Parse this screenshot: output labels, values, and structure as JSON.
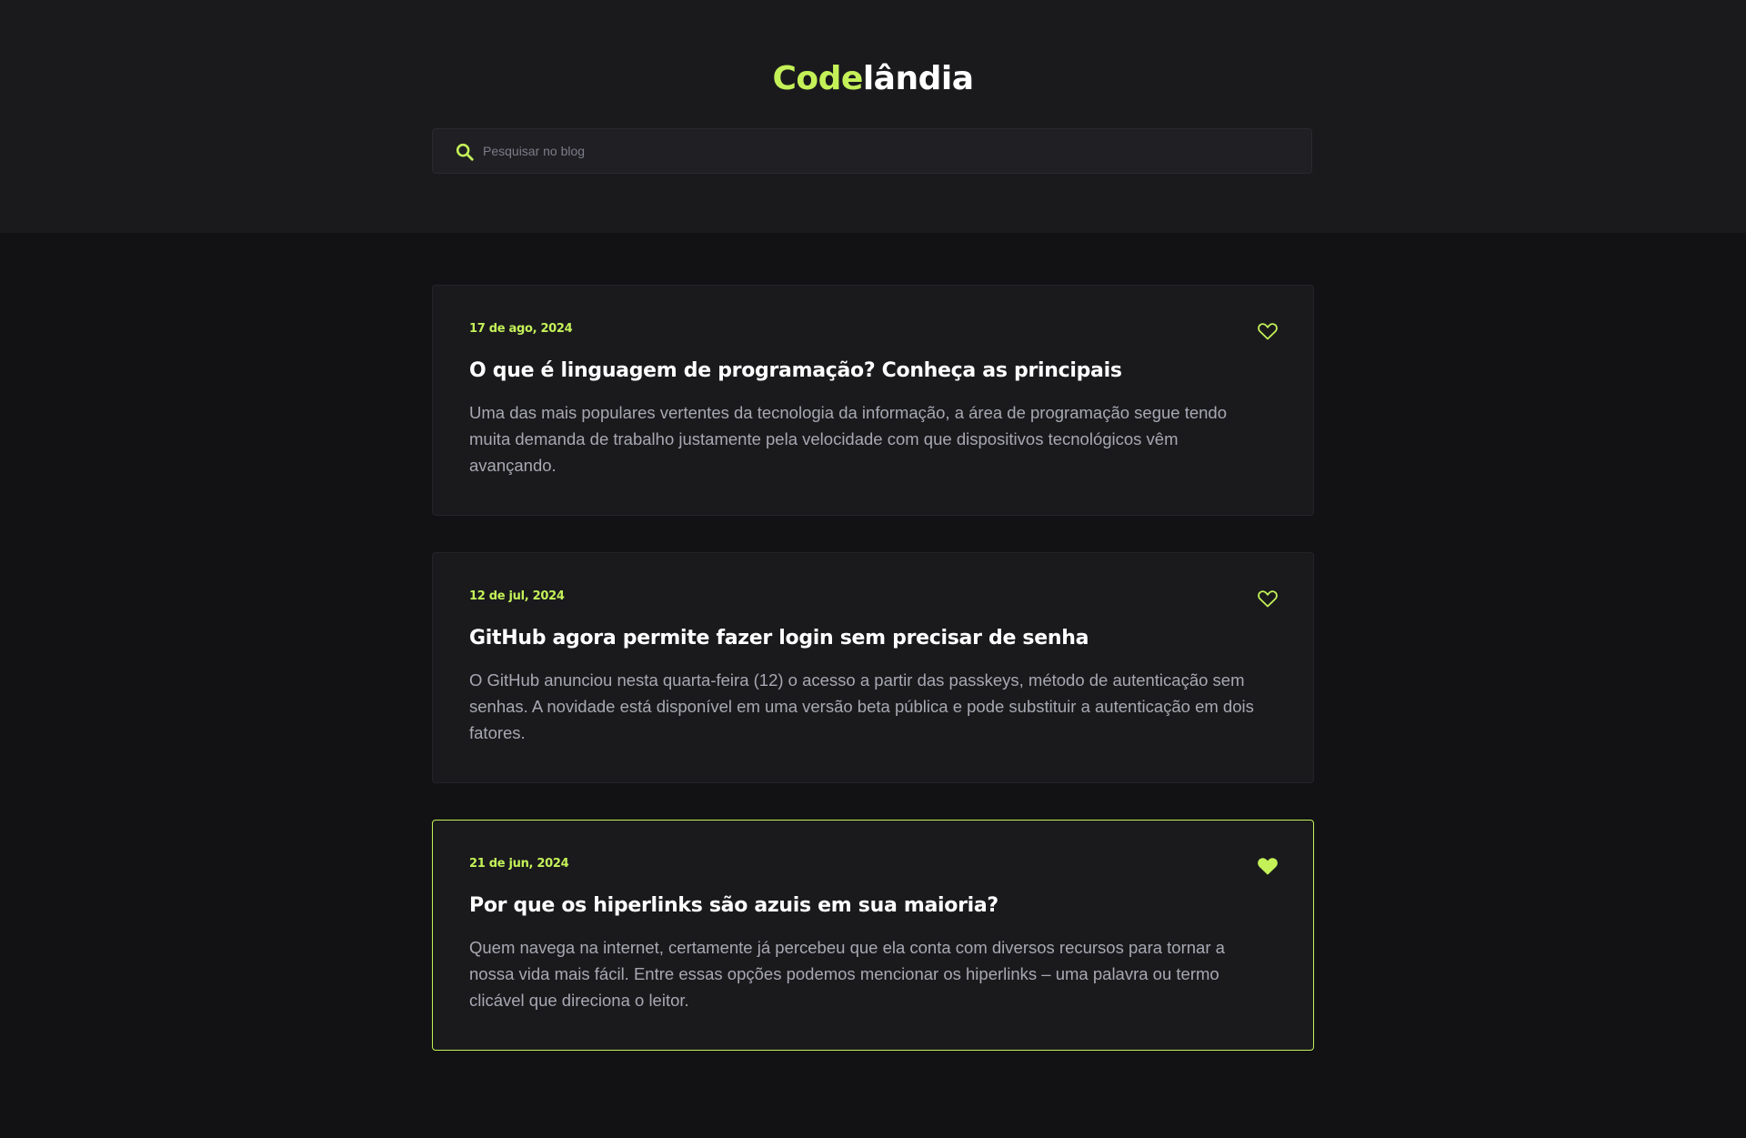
{
  "header": {
    "logo_part1": "Code",
    "logo_part2": "lândia",
    "accent_color": "#c4f158"
  },
  "search": {
    "placeholder": "Pesquisar no blog",
    "value": "",
    "icon": "search-icon"
  },
  "posts": [
    {
      "date": "17 de ago, 2024",
      "title": "O que é linguagem de programação? Conheça as principais",
      "excerpt": "Uma das mais populares vertentes da tecnologia da informação, a área de programação segue tendo muita demanda de trabalho justamente pela velocidade com que dispositivos tecnológicos vêm avançando.",
      "liked": false,
      "icon": "heart-outline-icon"
    },
    {
      "date": "12 de jul, 2024",
      "title": "GitHub agora permite fazer login sem precisar de senha",
      "excerpt": "O GitHub anunciou nesta quarta-feira (12) o acesso a partir das passkeys, método de autenticação sem senhas. A novidade está disponível em uma versão beta pública e pode substituir a autenticação em dois fatores.",
      "liked": false,
      "icon": "heart-outline-icon"
    },
    {
      "date": "21 de jun, 2024",
      "title": "Por que os hiperlinks são azuis em sua maioria?",
      "excerpt": "Quem navega na internet, certamente já percebeu que ela conta com diversos recursos para tornar a nossa vida mais fácil. Entre essas opções podemos mencionar os hiperlinks – uma palavra ou termo clicável que direciona o leitor.",
      "liked": true,
      "icon": "heart-filled-icon"
    }
  ]
}
